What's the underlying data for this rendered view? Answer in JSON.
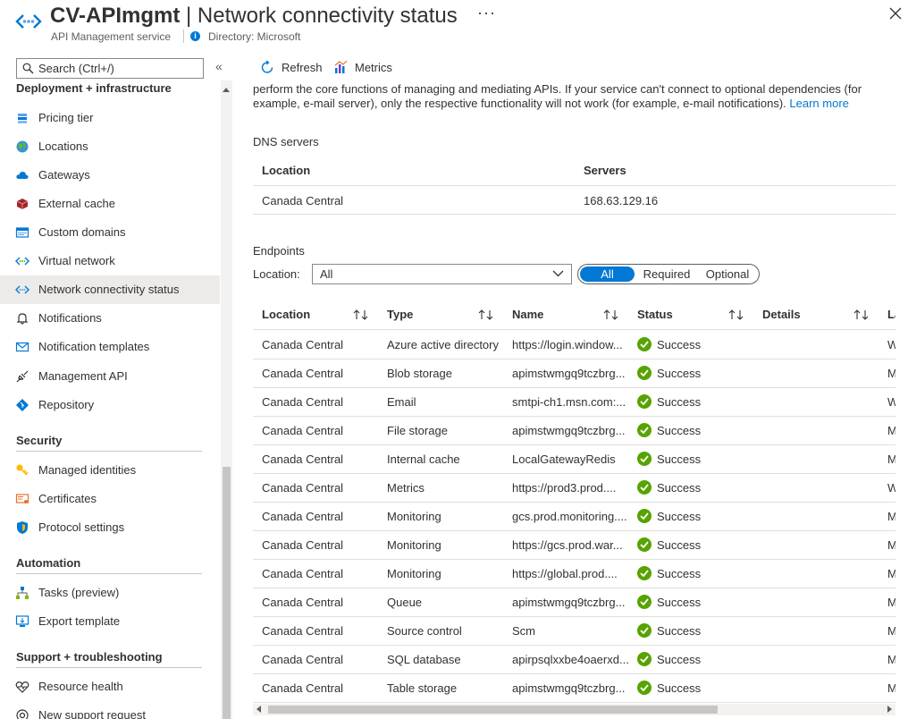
{
  "header": {
    "resource_name": "CV-APImgmt",
    "page_title": " | Network connectivity status",
    "more_label": "···",
    "service_type": "API Management service",
    "directory": "Directory: Microsoft"
  },
  "sidebar": {
    "search_placeholder": "Search (Ctrl+/)",
    "collapse_label": "«",
    "groups": [
      {
        "label": "Deployment + infrastructure",
        "items": [
          {
            "label": "Pricing tier",
            "icon": "pricing-tier-icon"
          },
          {
            "label": "Locations",
            "icon": "globe-icon"
          },
          {
            "label": "Gateways",
            "icon": "cloud-icon"
          },
          {
            "label": "External cache",
            "icon": "cache-icon"
          },
          {
            "label": "Custom domains",
            "icon": "custom-domains-icon"
          },
          {
            "label": "Virtual network",
            "icon": "virtual-network-icon"
          },
          {
            "label": "Network connectivity status",
            "icon": "network-status-icon",
            "active": true
          },
          {
            "label": "Notifications",
            "icon": "bell-icon"
          },
          {
            "label": "Notification templates",
            "icon": "envelope-icon"
          },
          {
            "label": "Management API",
            "icon": "plug-icon"
          },
          {
            "label": "Repository",
            "icon": "repository-icon"
          }
        ]
      },
      {
        "label": "Security",
        "items": [
          {
            "label": "Managed identities",
            "icon": "key-icon"
          },
          {
            "label": "Certificates",
            "icon": "certificate-icon"
          },
          {
            "label": "Protocol settings",
            "icon": "shield-icon"
          }
        ]
      },
      {
        "label": "Automation",
        "items": [
          {
            "label": "Tasks (preview)",
            "icon": "tasks-icon"
          },
          {
            "label": "Export template",
            "icon": "export-template-icon"
          }
        ]
      },
      {
        "label": "Support + troubleshooting",
        "items": [
          {
            "label": "Resource health",
            "icon": "heart-icon"
          },
          {
            "label": "New support request",
            "icon": "support-icon"
          }
        ]
      }
    ]
  },
  "toolbar": {
    "refresh_label": "Refresh",
    "metrics_label": "Metrics"
  },
  "intro": {
    "text": "perform the core functions of managing and mediating APIs. If your service can't connect to optional dependencies (for example, e-mail server), only the respective functionality will not work (for example, e-mail notifications).",
    "link": "Learn more"
  },
  "dns": {
    "title": "DNS servers",
    "columns": [
      "Location",
      "Servers"
    ],
    "rows": [
      [
        "Canada Central",
        "168.63.129.16"
      ]
    ]
  },
  "endpoints": {
    "title": "Endpoints",
    "location_label": "Location:",
    "location_value": "All",
    "filter_options": [
      "All",
      "Required",
      "Optional"
    ],
    "filter_selected": "All",
    "columns": [
      "Location",
      "Type",
      "Name",
      "Status",
      "Details",
      "La"
    ],
    "rows": [
      [
        "Canada Central",
        "Azure active directory",
        "https://login.window...",
        "Success",
        "",
        "W"
      ],
      [
        "Canada Central",
        "Blob storage",
        "apimstwmgq9tczbrg...",
        "Success",
        "",
        "M"
      ],
      [
        "Canada Central",
        "Email",
        "smtpi-ch1.msn.com:...",
        "Success",
        "",
        "W"
      ],
      [
        "Canada Central",
        "File storage",
        "apimstwmgq9tczbrg...",
        "Success",
        "",
        "M"
      ],
      [
        "Canada Central",
        "Internal cache",
        "LocalGatewayRedis",
        "Success",
        "",
        "M"
      ],
      [
        "Canada Central",
        "Metrics",
        "https://prod3.prod....",
        "Success",
        "",
        "W"
      ],
      [
        "Canada Central",
        "Monitoring",
        "gcs.prod.monitoring....",
        "Success",
        "",
        "M"
      ],
      [
        "Canada Central",
        "Monitoring",
        "https://gcs.prod.war...",
        "Success",
        "",
        "M"
      ],
      [
        "Canada Central",
        "Monitoring",
        "https://global.prod....",
        "Success",
        "",
        "M"
      ],
      [
        "Canada Central",
        "Queue",
        "apimstwmgq9tczbrg...",
        "Success",
        "",
        "M"
      ],
      [
        "Canada Central",
        "Source control",
        "Scm",
        "Success",
        "",
        "M"
      ],
      [
        "Canada Central",
        "SQL database",
        "apirpsqlxxbe4oaerxd...",
        "Success",
        "",
        "M"
      ],
      [
        "Canada Central",
        "Table storage",
        "apimstwmgq9tczbrg...",
        "Success",
        "",
        "M"
      ]
    ]
  },
  "colors": {
    "accent": "#0078d4",
    "success": "#57a300",
    "active_nav": "#edebe9"
  }
}
